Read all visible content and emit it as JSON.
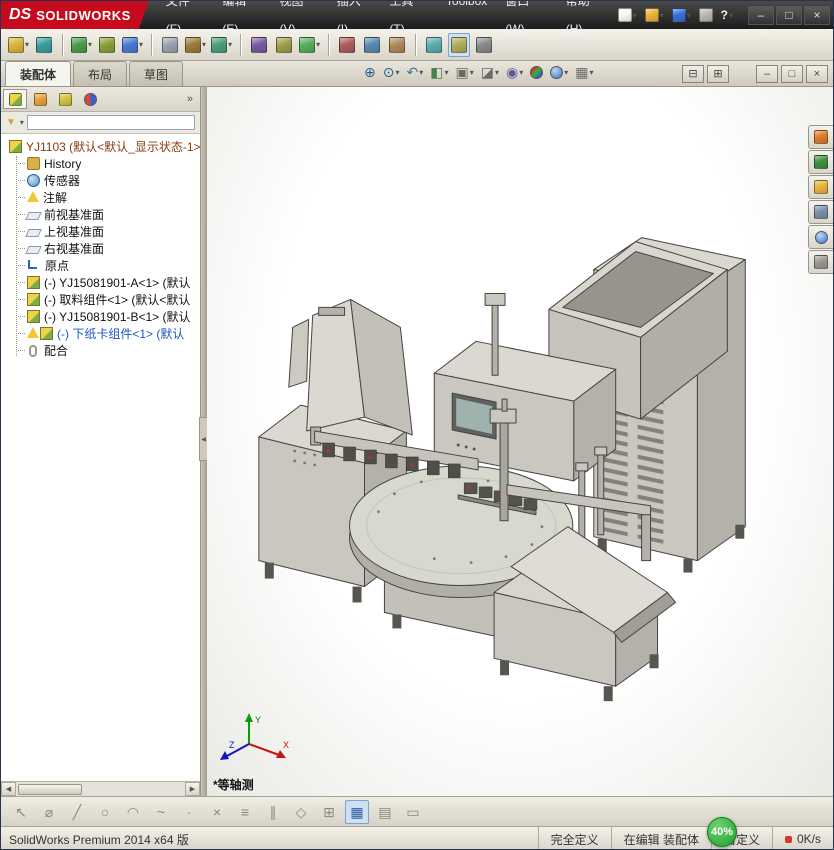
{
  "title_bar": {
    "logo_ds": "DS",
    "logo_text": "SOLIDWORKS",
    "menus": [
      "文件(F)",
      "编辑(E)",
      "视图(V)",
      "插入(I)",
      "工具(T)",
      "Toolbox",
      "窗口(W)",
      "帮助(H)"
    ],
    "quick_icons": [
      {
        "name": "new-document-icon",
        "color": "#f8f8f4",
        "arrow": true
      },
      {
        "name": "open-document-icon",
        "color": "#e8b43a",
        "arrow": true
      },
      {
        "name": "save-document-icon",
        "color": "#3a6fd8",
        "arrow": true
      },
      {
        "name": "print-icon",
        "color": "#b8b8b0"
      },
      {
        "name": "help-icon",
        "glyph": "?",
        "color": "#f0f0ea",
        "arrow": true
      }
    ],
    "window_controls": [
      {
        "name": "minimize-button",
        "glyph": "–"
      },
      {
        "name": "restore-button",
        "glyph": "□"
      },
      {
        "name": "close-button",
        "glyph": "×"
      }
    ]
  },
  "assembly_toolbar": {
    "icons": [
      {
        "name": "insert-components-icon",
        "color": "#d8b43a",
        "arrow": true
      },
      {
        "name": "mate-icon",
        "color": "#3a9e9e"
      },
      {
        "name": "linear-component-pattern-icon",
        "color": "#4a9e4a",
        "arrow": true,
        "sep": true
      },
      {
        "name": "smart-fasteners-icon",
        "color": "#8a9e3a"
      },
      {
        "name": "move-component-icon",
        "color": "#4a7ad4",
        "arrow": true
      },
      {
        "name": "show-hidden-components-icon",
        "color": "#9aa4ae",
        "sep": true
      },
      {
        "name": "assembly-features-icon",
        "color": "#9e7a3a",
        "arrow": true
      },
      {
        "name": "reference-geometry-icon",
        "color": "#4a9e7a",
        "arrow": true
      },
      {
        "name": "new-motion-study-icon",
        "color": "#7a5a9e",
        "sep": true
      },
      {
        "name": "bill-of-materials-icon",
        "color": "#9e9e4a"
      },
      {
        "name": "exploded-view-icon",
        "color": "#5aae5a",
        "arrow": true
      },
      {
        "name": "interference-detection-icon",
        "color": "#ae5a5a",
        "sep": true
      },
      {
        "name": "clearance-verification-icon",
        "color": "#5a8aae"
      },
      {
        "name": "hole-alignment-icon",
        "color": "#ae8a5a"
      },
      {
        "name": "assembly-visualization-icon",
        "color": "#5aaeae",
        "sep": true
      },
      {
        "name": "instant3d-icon",
        "color": "#aeae5a",
        "active": true
      },
      {
        "name": "large-assembly-mode-icon",
        "color": "#8a8a8a"
      }
    ]
  },
  "command_tabs": {
    "items": [
      {
        "label": "装配体",
        "active": true
      },
      {
        "label": "布局",
        "active": false
      },
      {
        "label": "草图",
        "active": false
      }
    ]
  },
  "heads_up": {
    "icons": [
      {
        "name": "zoom-to-fit-icon",
        "glyph": "⊕",
        "color": "#2a5f8f"
      },
      {
        "name": "zoom-to-area-icon",
        "glyph": "⊙",
        "color": "#2a5f8f",
        "arrow": true
      },
      {
        "name": "previous-view-icon",
        "glyph": "↶",
        "color": "#4a6f9f",
        "arrow": true
      },
      {
        "name": "section-view-icon",
        "glyph": "◧",
        "color": "#4a7f4a",
        "arrow": true
      },
      {
        "name": "view-orientation-icon",
        "glyph": "▣",
        "color": "#6a6a64",
        "arrow": true
      },
      {
        "name": "display-style-icon",
        "glyph": "◪",
        "color": "#6a6a64",
        "arrow": true
      },
      {
        "name": "hide-show-items-icon",
        "glyph": "◉",
        "color": "#5a5a9e",
        "arrow": true
      },
      {
        "name": "edit-appearance-icon",
        "kind": "rgb"
      },
      {
        "name": "apply-scene-icon",
        "kind": "blue",
        "arrow": true
      },
      {
        "name": "view-settings-icon",
        "glyph": "▦",
        "color": "#6a6a64",
        "arrow": true
      }
    ]
  },
  "doc_window": {
    "icons": [
      {
        "name": "split-horizontal-icon",
        "glyph": "⊟"
      },
      {
        "name": "split-vertical-icon",
        "glyph": "⊞"
      },
      {
        "name": "minimize-doc-icon",
        "glyph": "–",
        "gap": true
      },
      {
        "name": "restore-doc-icon",
        "glyph": "□"
      },
      {
        "name": "close-doc-icon",
        "glyph": "×"
      }
    ]
  },
  "panel_tabs": {
    "overflow": "»",
    "icons": [
      {
        "name": "featuremanager-tab-icon",
        "cls": "grad-yg",
        "active": true
      },
      {
        "name": "propertymanager-tab-icon",
        "color": "#e8a03a"
      },
      {
        "name": "configurationmanager-tab-icon",
        "color": "#d4c43a"
      },
      {
        "name": "displaymanager-tab-icon",
        "kind": "rb"
      }
    ]
  },
  "feature_tree": {
    "items": [
      {
        "label": "YJ1103 (默认<默认_显示状态-1>)",
        "icon": "assembly",
        "color": "#8a3c10"
      },
      {
        "label": "History",
        "icon": "history"
      },
      {
        "label": "传感器",
        "icon": "sensors"
      },
      {
        "label": "注解",
        "icon": "annotations"
      },
      {
        "label": "前视基准面",
        "icon": "plane"
      },
      {
        "label": "上视基准面",
        "icon": "plane"
      },
      {
        "label": "右视基准面",
        "icon": "plane"
      },
      {
        "label": "原点",
        "icon": "origin"
      },
      {
        "label": "(-) YJ15081901-A<1> (默认",
        "icon": "component"
      },
      {
        "label": "(-) 取料组件<1> (默认<默认",
        "icon": "component"
      },
      {
        "label": "(-) YJ15081901-B<1> (默认",
        "icon": "component"
      },
      {
        "label": "(-) 下纸卡组件<1> (默认",
        "icon": "component-warn",
        "color": "#1a56c4"
      },
      {
        "label": "配合",
        "icon": "mates"
      }
    ]
  },
  "viewport": {
    "view_label": "*等轴测",
    "axes": {
      "x": "X",
      "y": "Y",
      "z": "Z"
    }
  },
  "task_pane": {
    "icons": [
      {
        "name": "resources-home-icon",
        "color": "#e07b2a"
      },
      {
        "name": "design-library-icon",
        "color": "#3f8f3f"
      },
      {
        "name": "file-explorer-icon",
        "color": "#e8b43a"
      },
      {
        "name": "view-palette-icon",
        "color": "#7a8fa8"
      },
      {
        "name": "appearances-scenes-icon",
        "kind": "blue"
      },
      {
        "name": "custom-properties-icon",
        "color": "#9a9a92"
      }
    ]
  },
  "sketch_toolbar": {
    "icons": [
      {
        "name": "select-tool-icon",
        "glyph": "↖"
      },
      {
        "name": "smart-dimension-icon",
        "glyph": "⌀"
      },
      {
        "name": "line-tool-icon",
        "glyph": "╱"
      },
      {
        "name": "circle-tool-icon",
        "glyph": "○"
      },
      {
        "name": "arc-tool-icon",
        "glyph": "◠"
      },
      {
        "name": "spline-tool-icon",
        "glyph": "~"
      },
      {
        "name": "point-tool-icon",
        "glyph": "·"
      },
      {
        "name": "trim-entities-icon",
        "glyph": "×"
      },
      {
        "name": "convert-entities-icon",
        "glyph": "≡"
      },
      {
        "name": "offset-entities-icon",
        "glyph": "∥"
      },
      {
        "name": "mirror-entities-icon",
        "glyph": "◇"
      },
      {
        "name": "sketch-pattern-icon",
        "glyph": "⊞"
      },
      {
        "name": "display-grid-icon",
        "glyph": "▦",
        "active": true
      },
      {
        "name": "sketch-table-icon",
        "glyph": "▤"
      },
      {
        "name": "rapid-sketch-icon",
        "glyph": "▭"
      }
    ]
  },
  "status_bar": {
    "left": "SolidWorks Premium 2014 x64 版",
    "cells": [
      {
        "name": "define-status",
        "text": "完全定义"
      },
      {
        "name": "edit-status",
        "text": "在编辑 装配体"
      },
      {
        "name": "custom-status",
        "text": "自定义"
      }
    ],
    "badge": "40%",
    "speed": "0K/s"
  }
}
